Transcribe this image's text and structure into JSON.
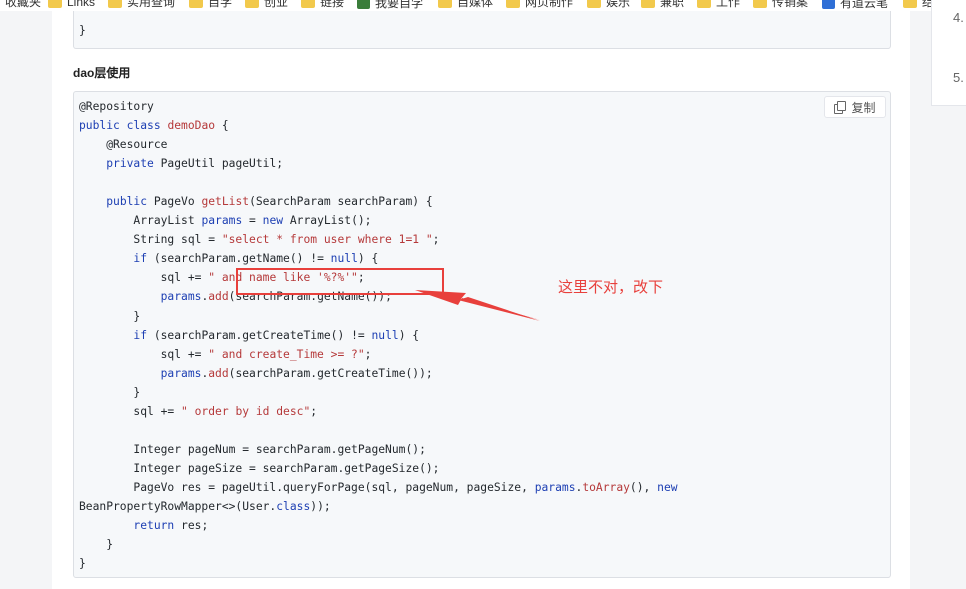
{
  "bookmarks": [
    {
      "label": "收藏夹",
      "icon": "folder-icon"
    },
    {
      "label": "Links",
      "icon": "folder-icon"
    },
    {
      "label": "实用查询",
      "icon": "folder-icon"
    },
    {
      "label": "自学",
      "icon": "folder-icon"
    },
    {
      "label": "创业",
      "icon": "folder-icon"
    },
    {
      "label": "链接",
      "icon": "folder-icon"
    },
    {
      "label": "我要自学",
      "icon": "site-icon"
    },
    {
      "label": "自媒体",
      "icon": "folder-icon"
    },
    {
      "label": "网页制作",
      "icon": "folder-icon"
    },
    {
      "label": "娱乐",
      "icon": "folder-icon"
    },
    {
      "label": "兼职",
      "icon": "folder-icon"
    },
    {
      "label": "工作",
      "icon": "folder-icon"
    },
    {
      "label": "传销案",
      "icon": "folder-icon"
    },
    {
      "label": "有道云笔",
      "icon": "site-icon"
    },
    {
      "label": "结婚大事",
      "icon": "folder-icon"
    }
  ],
  "prev_code": {
    "closing": "}"
  },
  "section": {
    "heading": "dao层使用"
  },
  "copy_button": {
    "label": "复制",
    "icon": "copy-icon"
  },
  "code": {
    "language": "java",
    "lines": [
      "@Repository",
      "public class demoDao {",
      "    @Resource",
      "    private PageUtil pageUtil;",
      "",
      "    public PageVo getList(SearchParam searchParam) {",
      "        ArrayList params = new ArrayList();",
      "        String sql = \"select * from user where 1=1 \";",
      "        if (searchParam.getName() != null) {",
      "            sql += \" and name like '%?%'\";",
      "            params.add(searchParam.getName());",
      "        }",
      "        if (searchParam.getCreateTime() != null) {",
      "            sql += \" and create_Time >= ?\";",
      "            params.add(searchParam.getCreateTime());",
      "        }",
      "        sql += \" order by id desc\";",
      "",
      "        Integer pageNum = searchParam.getPageNum();",
      "        Integer pageSize = searchParam.getPageSize();",
      "        PageVo res = pageUtil.queryForPage(sql, pageNum, pageSize, params.toArray(), new",
      "BeanPropertyRowMapper<>(User.class));",
      "        return res;",
      "    }",
      "}"
    ]
  },
  "annotation": {
    "text": "这里不对，改下",
    "color": "#e8403c"
  },
  "toc": [
    {
      "label": "4."
    },
    {
      "label": "5."
    }
  ]
}
